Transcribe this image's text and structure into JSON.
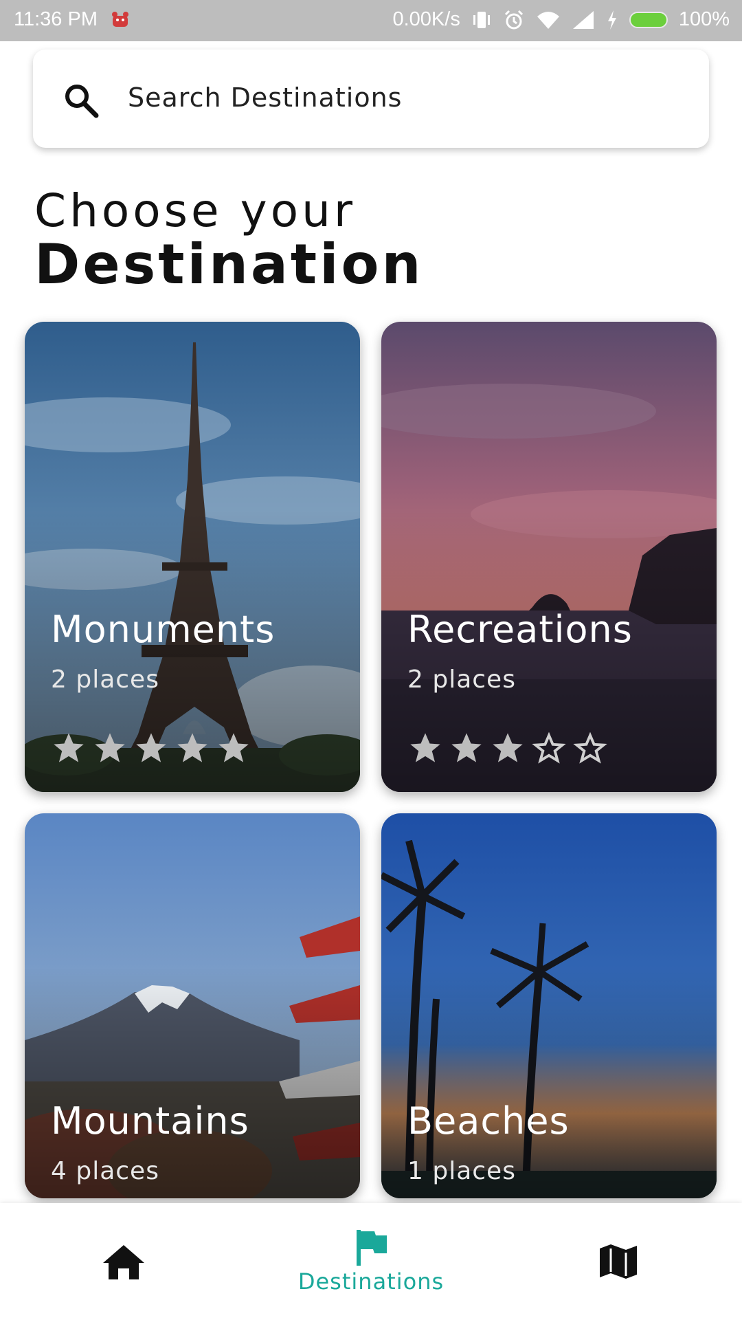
{
  "status_bar": {
    "time": "11:36 PM",
    "speed": "0.00K/s",
    "battery": "100%"
  },
  "search": {
    "placeholder": "Search Destinations",
    "icon": "search-icon"
  },
  "heading": {
    "line1": "Choose your",
    "line2": "Destination"
  },
  "cards": [
    {
      "name": "Monuments",
      "places": "2 places",
      "rating": 5,
      "max_rating": 5
    },
    {
      "name": "Recreations",
      "places": "2 places",
      "rating": 3,
      "max_rating": 5
    },
    {
      "name": "Mountains",
      "places": "4 places"
    },
    {
      "name": "Beaches",
      "places": "1 places"
    }
  ],
  "bottom_nav": {
    "items": [
      {
        "icon": "home-icon",
        "label": ""
      },
      {
        "icon": "flag-icon",
        "label": "Destinations",
        "active": true
      },
      {
        "icon": "map-icon",
        "label": ""
      }
    ]
  },
  "colors": {
    "accent": "#1aa89a",
    "status_bar": "#bdbdbd"
  }
}
